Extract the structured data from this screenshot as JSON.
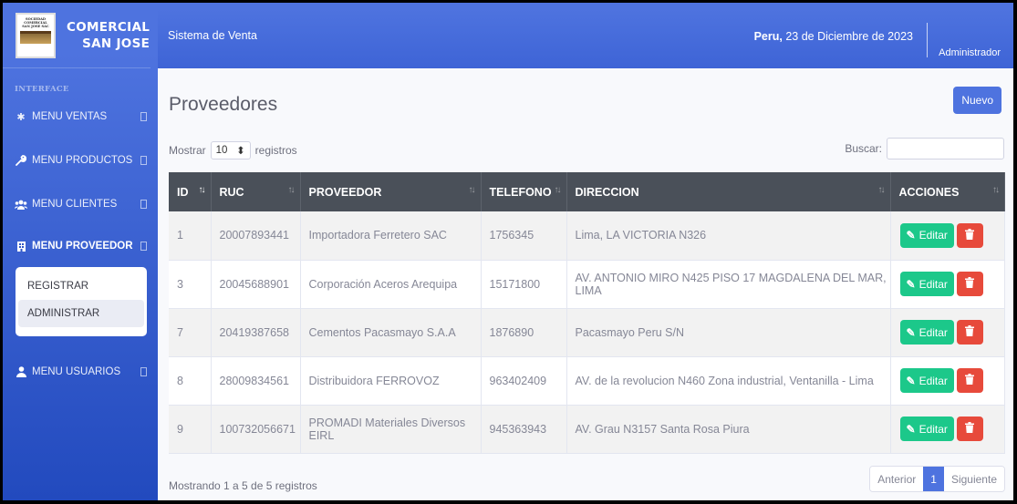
{
  "brand": {
    "logo_lines": [
      "SOCIEDAD",
      "COMERCIAL",
      "SAN JOSE SAC"
    ],
    "line1": "COMERCIAL",
    "line2": "SAN JOSE"
  },
  "sidebar": {
    "section": "INTERFACE",
    "items": [
      {
        "label": "MENU VENTAS",
        "icon": "gear-icon"
      },
      {
        "label": "MENU PRODUCTOS",
        "icon": "wrench-icon"
      },
      {
        "label": "MENU CLIENTES",
        "icon": "users-icon"
      },
      {
        "label": "MENU PROVEEDOR",
        "icon": "building-icon"
      },
      {
        "label": "MENU USUARIOS",
        "icon": "user-icon"
      }
    ],
    "submenu": [
      {
        "label": "REGISTRAR"
      },
      {
        "label": "ADMINISTRAR"
      }
    ]
  },
  "topbar": {
    "system_name": "Sistema de Venta",
    "date_bold": "Peru,",
    "date_rest": " 23 de Diciembre de 2023",
    "user": "Administrador"
  },
  "main": {
    "title": "Proveedores",
    "new_button": "Nuevo",
    "show_label": "Mostrar",
    "page_size": "10",
    "records_label": "registros",
    "search_label": "Buscar:",
    "search_value": "",
    "columns": [
      "ID",
      "RUC",
      "PROVEEDOR",
      "TELEFONO",
      "DIRECCION",
      "ACCIONES"
    ],
    "rows": [
      {
        "id": "1",
        "ruc": "20007893441",
        "proveedor": "Importadora Ferretero SAC",
        "telefono": "1756345",
        "direccion": "Lima, LA VICTORIA N326"
      },
      {
        "id": "3",
        "ruc": "20045688901",
        "proveedor": "Corporación Aceros Arequipa",
        "telefono": "15171800",
        "direccion": "AV. ANTONIO MIRO N425 PISO 17 MAGDALENA DEL MAR, LIMA"
      },
      {
        "id": "7",
        "ruc": "20419387658",
        "proveedor": "Cementos Pacasmayo S.A.A",
        "telefono": "1876890",
        "direccion": "Pacasmayo Peru S/N"
      },
      {
        "id": "8",
        "ruc": "28009834561",
        "proveedor": "Distribuidora FERROVOZ",
        "telefono": "963402409",
        "direccion": "AV. de la revolucion N460 Zona industrial, Ventanilla - Lima"
      },
      {
        "id": "9",
        "ruc": "100732056671",
        "proveedor": "PROMADI Materiales Diversos EIRL",
        "telefono": "945363943",
        "direccion": "AV. Grau N3157 Santa Rosa Piura"
      }
    ],
    "edit_label": "Editar",
    "info": "Mostrando 1 a 5 de 5 registros",
    "pager": {
      "prev": "Anterior",
      "current": "1",
      "next": "Siguiente"
    }
  }
}
